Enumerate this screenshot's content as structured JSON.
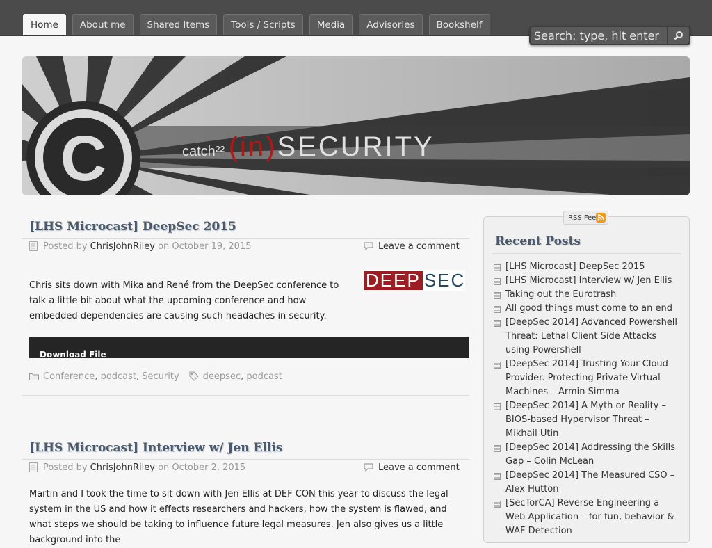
{
  "nav": {
    "tabs": [
      "Home",
      "About me",
      "Shared Items",
      "Tools / Scripts",
      "Media",
      "Advisories",
      "Bookshelf"
    ],
    "active": "Home"
  },
  "search": {
    "placeholder": "Search: type, hit enter"
  },
  "banner": {
    "logo_text": "catch²² (in)SECURITY",
    "logo_letter": "C"
  },
  "posts": [
    {
      "title": "[LHS Microcast] DeepSec 2015",
      "posted_by_prefix": "Posted by",
      "author": "ChrisJohnRiley",
      "date_prefix": "on",
      "date": "October 19, 2015",
      "comment_link": "Leave a comment",
      "body_before_link": "Chris sits down with Mika and René from the",
      "body_link": " DeepSec",
      "body_after_link": " conference to talk a little bit about what the upcoming conference and how embedded dependencies are causing such headaches in security.",
      "image_logo": {
        "left": "DEEP",
        "right": "SEC"
      },
      "download_label": "Download File",
      "categories": [
        "Conference",
        "podcast",
        "Security"
      ],
      "tags": [
        "deepsec",
        "podcast"
      ]
    },
    {
      "title": "[LHS Microcast] Interview w/ Jen Ellis",
      "posted_by_prefix": "Posted by",
      "author": "ChrisJohnRiley",
      "date_prefix": "on",
      "date": "October 2, 2015",
      "comment_link": "Leave a comment",
      "body": "Martin and I took the time to sit down with Jen Ellis at DEF CON this year to discuss the legal system in the US and how it effects researchers and hackers, how the system is flawed, and what steps we should be taking to influence future legal measures. Jen also gives us a little background into the"
    }
  ],
  "sidebar": {
    "rss_label": "RSS Feed",
    "title": "Recent Posts",
    "items": [
      "[LHS Microcast] DeepSec 2015",
      "[LHS Microcast] Interview w/ Jen Ellis",
      "Taking out the Eurotrash",
      "All good things must come to an end",
      "[DeepSec 2014] Advanced Powershell Threat: Lethal Client Side Attacks using Powershell",
      "[DeepSec 2014] Trusting Your Cloud Provider. Protecting Private Virtual Machines – Armin Simma",
      "[DeepSec 2014] A Myth or Reality – BIOS-based Hypervisor Threat – Mikhail Utin",
      "[DeepSec 2014] Addressing the Skills Gap – Colin McLean",
      "[DeepSec 2014] The Measured CSO – Alex Hutton",
      "[SecTorCA] Reverse Engineering a Web Application – for fun, behavior & WAF Detection"
    ]
  }
}
